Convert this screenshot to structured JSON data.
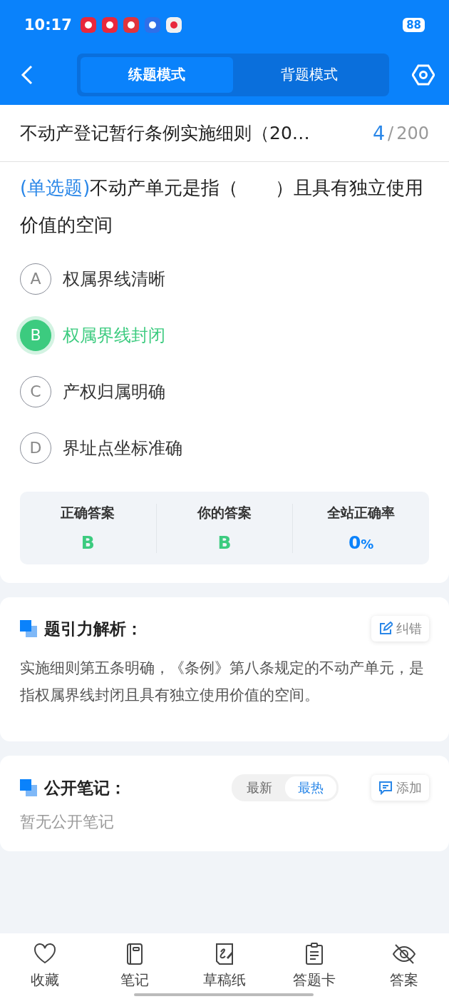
{
  "status_bar": {
    "time": "10:17",
    "battery": "88"
  },
  "header": {
    "tabs": [
      {
        "label": "练题模式",
        "selected": true
      },
      {
        "label": "背题模式",
        "selected": false
      }
    ]
  },
  "title_bar": {
    "title": "不动产登记暂行条例实施细则（20…",
    "current": "4",
    "separator": "/",
    "total": "200"
  },
  "question": {
    "type": "(单选题)",
    "text": "不动产单元是指（　　）且具有独立使用价值的空间",
    "options": [
      {
        "letter": "A",
        "text": "权属界线清晰",
        "selected": false
      },
      {
        "letter": "B",
        "text": "权属界线封闭",
        "selected": true
      },
      {
        "letter": "C",
        "text": "产权归属明确",
        "selected": false
      },
      {
        "letter": "D",
        "text": "界址点坐标准确",
        "selected": false
      }
    ]
  },
  "answer_panel": {
    "stats": [
      {
        "label": "正确答案",
        "value": "B",
        "kind": "answer"
      },
      {
        "label": "你的答案",
        "value": "B",
        "kind": "answer"
      },
      {
        "label": "全站正确率",
        "value": "0",
        "unit": "%",
        "kind": "rate"
      }
    ]
  },
  "analysis": {
    "title": "题引力解析：",
    "action": "纠错",
    "text": "实施细则第五条明确，《条例》第八条规定的不动产单元，是指权属界线封闭且具有独立使用价值的空间。"
  },
  "notes": {
    "title": "公开笔记：",
    "sort_tabs": [
      {
        "label": "最新",
        "selected": false
      },
      {
        "label": "最热",
        "selected": true
      }
    ],
    "action": "添加",
    "empty": "暂无公开笔记"
  },
  "bottom_nav": {
    "items": [
      {
        "label": "收藏"
      },
      {
        "label": "笔记"
      },
      {
        "label": "草稿纸"
      },
      {
        "label": "答题卡"
      },
      {
        "label": "答案"
      }
    ]
  }
}
